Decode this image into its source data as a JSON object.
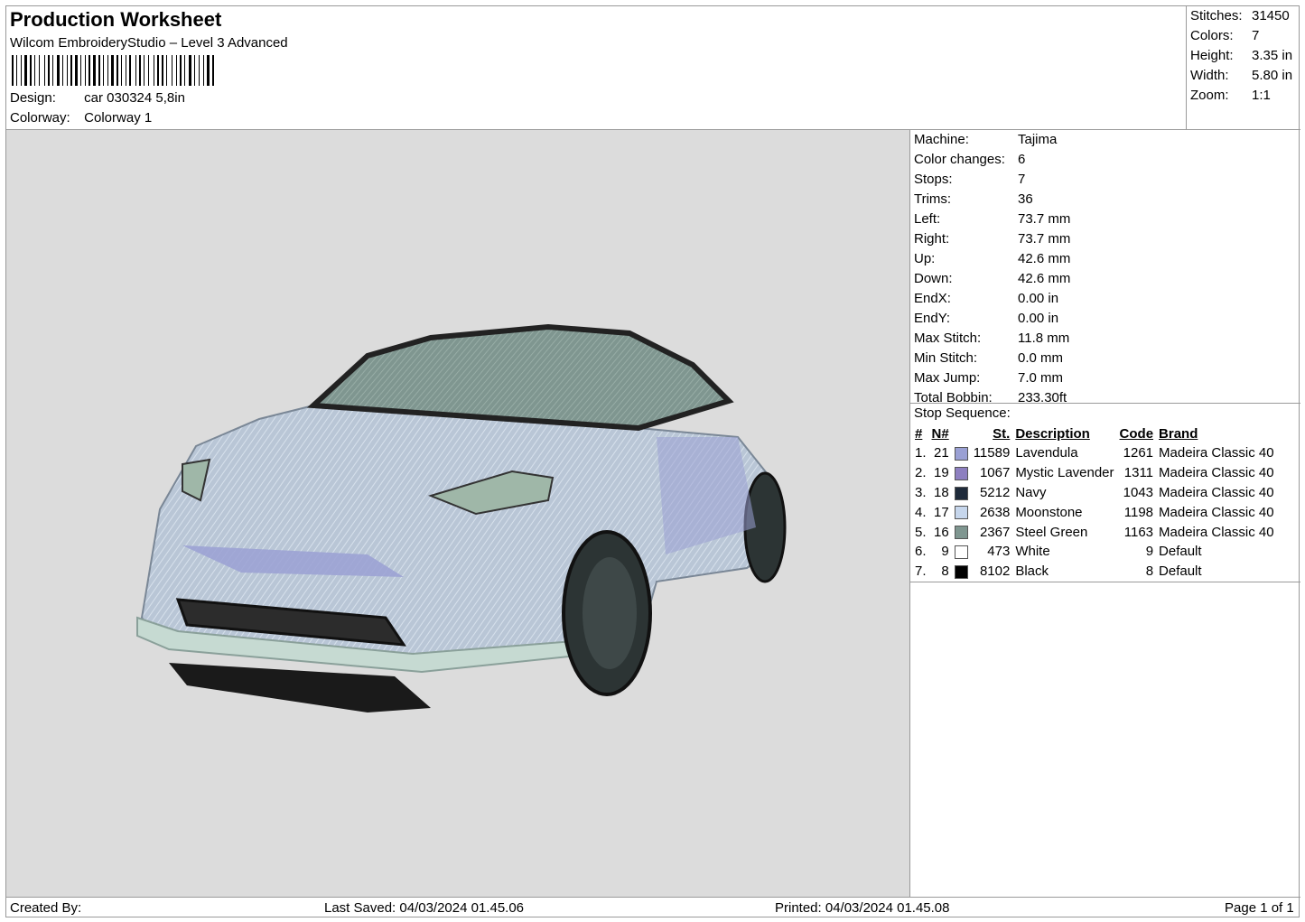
{
  "header": {
    "title": "Production Worksheet",
    "subtitle": "Wilcom EmbroideryStudio – Level 3 Advanced",
    "design_label": "Design:",
    "design_value": "car 030324 5,8in",
    "colorway_label": "Colorway:",
    "colorway_value": "Colorway 1"
  },
  "top_stats": [
    {
      "label": "Stitches:",
      "value": "31450"
    },
    {
      "label": "Colors:",
      "value": "7"
    },
    {
      "label": "Height:",
      "value": "3.35 in"
    },
    {
      "label": "Width:",
      "value": "5.80 in"
    },
    {
      "label": "Zoom:",
      "value": "1:1"
    }
  ],
  "machine_info": [
    {
      "label": "Machine:",
      "value": "Tajima"
    },
    {
      "label": "Color changes:",
      "value": "6"
    },
    {
      "label": "Stops:",
      "value": "7"
    },
    {
      "label": "Trims:",
      "value": "36"
    },
    {
      "label": "Left:",
      "value": "73.7 mm"
    },
    {
      "label": "Right:",
      "value": "73.7 mm"
    },
    {
      "label": "Up:",
      "value": "42.6 mm"
    },
    {
      "label": "Down:",
      "value": "42.6 mm"
    },
    {
      "label": "EndX:",
      "value": "0.00 in"
    },
    {
      "label": "EndY:",
      "value": "0.00 in"
    },
    {
      "label": "Max Stitch:",
      "value": "11.8 mm"
    },
    {
      "label": "Min Stitch:",
      "value": "0.0 mm"
    },
    {
      "label": "Max Jump:",
      "value": "7.0 mm"
    },
    {
      "label": "Total Bobbin:",
      "value": "233.30ft"
    }
  ],
  "stop_sequence": {
    "title": "Stop Sequence:",
    "headers": {
      "idx": "#",
      "n": "N#",
      "st": "St.",
      "desc": "Description",
      "code": "Code",
      "brand": "Brand"
    },
    "rows": [
      {
        "idx": "1.",
        "n": "21",
        "color": "#9aa0d4",
        "st": "11589",
        "desc": "Lavendula",
        "code": "1261",
        "brand": "Madeira Classic 40"
      },
      {
        "idx": "2.",
        "n": "19",
        "color": "#8d7fc0",
        "st": "1067",
        "desc": "Mystic Lavender",
        "code": "1311",
        "brand": "Madeira Classic 40"
      },
      {
        "idx": "3.",
        "n": "18",
        "color": "#1e2a3a",
        "st": "5212",
        "desc": "Navy",
        "code": "1043",
        "brand": "Madeira Classic 40"
      },
      {
        "idx": "4.",
        "n": "17",
        "color": "#c6d6ec",
        "st": "2638",
        "desc": "Moonstone",
        "code": "1198",
        "brand": "Madeira Classic 40"
      },
      {
        "idx": "5.",
        "n": "16",
        "color": "#7f9690",
        "st": "2367",
        "desc": "Steel Green",
        "code": "1163",
        "brand": "Madeira Classic 40"
      },
      {
        "idx": "6.",
        "n": "9",
        "color": "#ffffff",
        "st": "473",
        "desc": "White",
        "code": "9",
        "brand": "Default"
      },
      {
        "idx": "7.",
        "n": "8",
        "color": "#000000",
        "st": "8102",
        "desc": "Black",
        "code": "8",
        "brand": "Default"
      }
    ]
  },
  "footer": {
    "created_by": "Created By:",
    "last_saved": "Last Saved: 04/03/2024 01.45.06",
    "printed": "Printed: 04/03/2024 01.45.08",
    "page": "Page 1 of 1"
  }
}
